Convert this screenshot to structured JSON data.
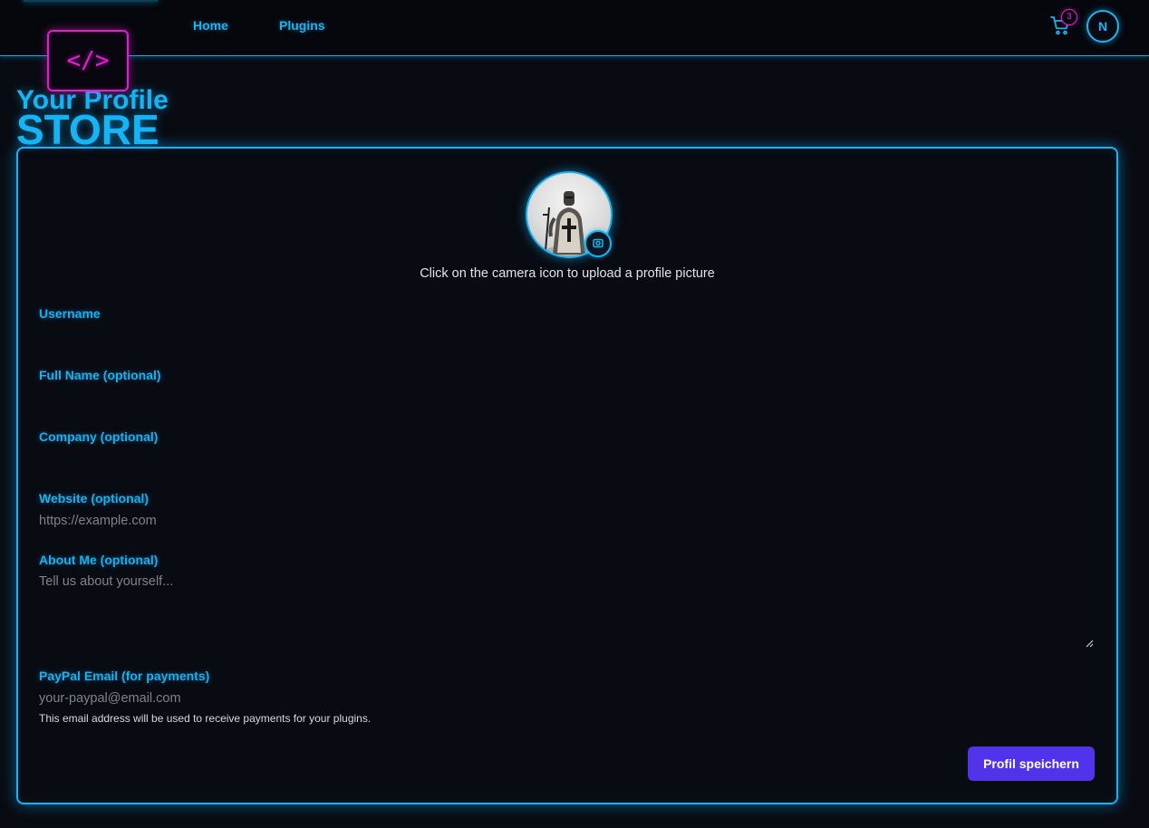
{
  "nav": {
    "home": "Home",
    "plugins": "Plugins",
    "cart_icon": "shopping-cart-icon",
    "cart_count": "3",
    "avatar_initial": "N"
  },
  "logo": {
    "code_glyph": "</>",
    "store": "STORE"
  },
  "page": {
    "title": "Your Profile"
  },
  "profile": {
    "picture_icon": "profile-picture",
    "camera_icon": "camera-icon",
    "upload_hint": "Click on the camera icon to upload a profile picture"
  },
  "form": {
    "username": {
      "label": "Username",
      "value": "",
      "placeholder": ""
    },
    "full_name": {
      "label": "Full Name (optional)",
      "value": "",
      "placeholder": ""
    },
    "company": {
      "label": "Company (optional)",
      "value": "",
      "placeholder": ""
    },
    "website": {
      "label": "Website (optional)",
      "value": "",
      "placeholder": "https://example.com"
    },
    "about": {
      "label": "About Me (optional)",
      "value": "",
      "placeholder": "Tell us about yourself..."
    },
    "paypal": {
      "label": "PayPal Email (for payments)",
      "value": "",
      "placeholder": "your-paypal@email.com",
      "help": "This email address will be used to receive payments for your plugins."
    },
    "save_label": "Profil speichern"
  },
  "colors": {
    "background": "#090b12",
    "neon_blue": "#16b2f0",
    "neon_magenta": "#e020d0",
    "button": "#5133ea"
  }
}
